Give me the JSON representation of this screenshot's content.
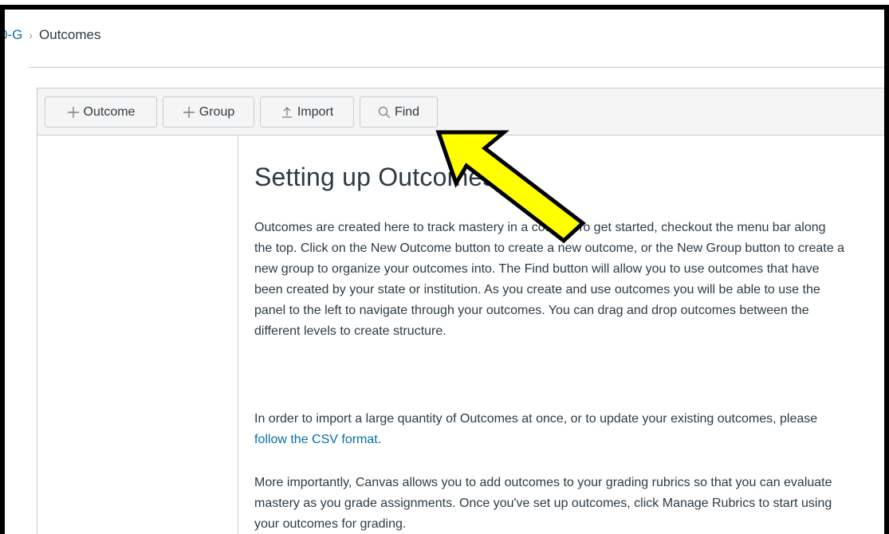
{
  "breadcrumb": {
    "course": "0-G",
    "separator": "›",
    "current": "Outcomes"
  },
  "toolbar": {
    "buttons": [
      {
        "label": "Outcome",
        "icon": "plus-icon"
      },
      {
        "label": "Group",
        "icon": "plus-icon"
      },
      {
        "label": "Import",
        "icon": "upload-icon"
      },
      {
        "label": "Find",
        "icon": "search-icon"
      }
    ]
  },
  "main": {
    "title": "Setting up Outcomes",
    "paragraph1": "Outcomes are created here to track mastery in a course. To get started, checkout the menu bar along the top. Click on the New Outcome button to create a new outcome, or the New Group button to create a new group to organize your outcomes into. The Find button will allow you to use outcomes that have been created by your state or institution. As you create and use outcomes you will be able to use the panel to the left to navigate through your outcomes. You can drag and drop outcomes between the different levels to create structure.",
    "paragraph2_before": "In order to import a large quantity of Outcomes at once, or to update your existing outcomes, please ",
    "paragraph2_link": "follow the CSV format",
    "paragraph2_after": ".",
    "paragraph3": "More importantly, Canvas allows you to add outcomes to your grading rubrics so that you can evaluate mastery as you grade assignments. Once you've set up outcomes, click Manage Rubrics to start using your outcomes for grading."
  },
  "colors": {
    "link": "#0770a3",
    "text": "#2d3b45",
    "toolbar_bg": "#f5f5f5",
    "border": "#c7cdd1",
    "annotation_arrow": "#ffff00"
  }
}
